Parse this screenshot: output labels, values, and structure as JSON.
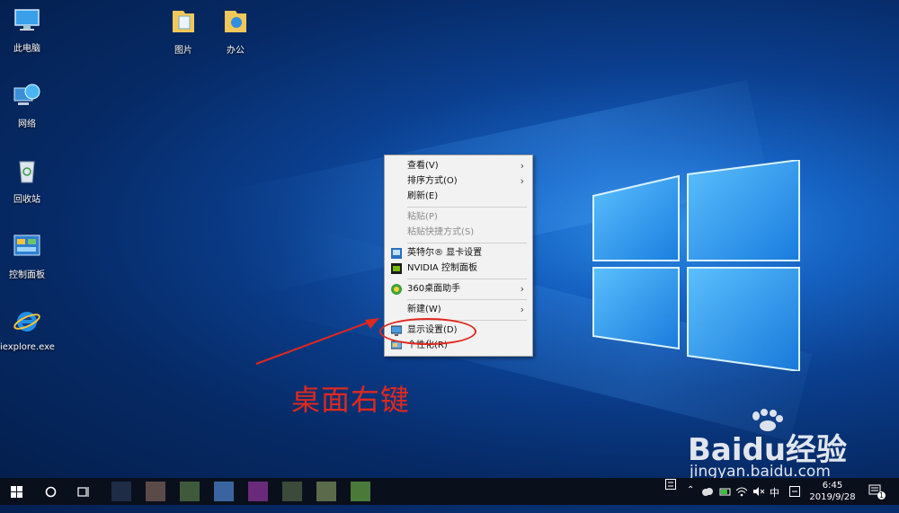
{
  "desktop": {
    "icons": [
      {
        "label": "此电脑",
        "icon": "this-pc-icon"
      },
      {
        "label": "网络",
        "icon": "network-icon"
      },
      {
        "label": "回收站",
        "icon": "recycle-bin-icon"
      },
      {
        "label": "控制面板",
        "icon": "control-panel-icon"
      },
      {
        "label": "iexplore.exe",
        "icon": "internet-explorer-icon"
      },
      {
        "label": "图片",
        "icon": "folder-icon"
      },
      {
        "label": "办公",
        "icon": "folder-icon"
      }
    ]
  },
  "context_menu": {
    "items": [
      {
        "label": "查看(V)",
        "submenu": true,
        "enabled": true
      },
      {
        "label": "排序方式(O)",
        "submenu": true,
        "enabled": true
      },
      {
        "label": "刷新(E)",
        "submenu": false,
        "enabled": true
      },
      {
        "label": "粘贴(P)",
        "submenu": false,
        "enabled": false
      },
      {
        "label": "粘贴快捷方式(S)",
        "submenu": false,
        "enabled": false
      },
      {
        "label": "英特尔® 显卡设置",
        "submenu": false,
        "enabled": true,
        "icon": "intel-graphics-icon"
      },
      {
        "label": "NVIDIA 控制面板",
        "submenu": false,
        "enabled": true,
        "icon": "nvidia-icon"
      },
      {
        "label": "360桌面助手",
        "submenu": true,
        "enabled": true,
        "icon": "360-icon"
      },
      {
        "label": "新建(W)",
        "submenu": true,
        "enabled": true
      },
      {
        "label": "显示设置(D)",
        "submenu": false,
        "enabled": true,
        "icon": "display-icon"
      },
      {
        "label": "个性化(R)",
        "submenu": false,
        "enabled": true,
        "icon": "personalize-icon"
      }
    ]
  },
  "annotation": {
    "text": "桌面右键",
    "color": "#e0281e"
  },
  "watermark": {
    "brand": "Baidu经验",
    "url": "jingyan.baidu.com"
  },
  "taskbar": {
    "clock_time": "6:45",
    "clock_date": "2019/9/28",
    "ime_label": "中",
    "notification_count": "1"
  }
}
